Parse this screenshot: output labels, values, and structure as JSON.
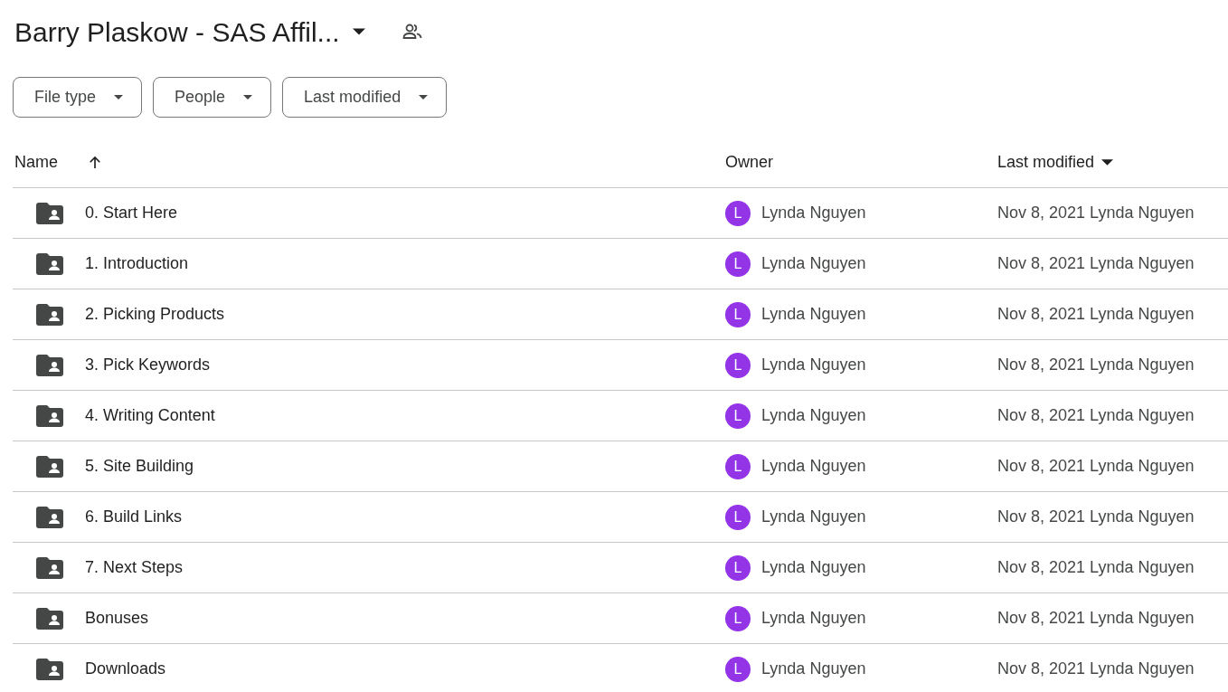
{
  "folder_title": "Barry Plaskow - SAS Affil...",
  "filters": [
    {
      "label": "File type"
    },
    {
      "label": "People"
    },
    {
      "label": "Last modified"
    }
  ],
  "columns": [
    {
      "label": "Name"
    },
    {
      "label": "Owner"
    },
    {
      "label": "Last modified"
    }
  ],
  "rows": [
    {
      "name": "0. Start Here",
      "owner_initial": "L",
      "owner": "Lynda Nguyen",
      "modified_date": "Nov 8, 2021",
      "modified_by": "Lynda Nguyen"
    },
    {
      "name": "1. Introduction",
      "owner_initial": "L",
      "owner": "Lynda Nguyen",
      "modified_date": "Nov 8, 2021",
      "modified_by": "Lynda Nguyen"
    },
    {
      "name": "2. Picking Products",
      "owner_initial": "L",
      "owner": "Lynda Nguyen",
      "modified_date": "Nov 8, 2021",
      "modified_by": "Lynda Nguyen"
    },
    {
      "name": "3. Pick Keywords",
      "owner_initial": "L",
      "owner": "Lynda Nguyen",
      "modified_date": "Nov 8, 2021",
      "modified_by": "Lynda Nguyen"
    },
    {
      "name": "4. Writing Content",
      "owner_initial": "L",
      "owner": "Lynda Nguyen",
      "modified_date": "Nov 8, 2021",
      "modified_by": "Lynda Nguyen"
    },
    {
      "name": "5. Site Building",
      "owner_initial": "L",
      "owner": "Lynda Nguyen",
      "modified_date": "Nov 8, 2021",
      "modified_by": "Lynda Nguyen"
    },
    {
      "name": "6. Build Links",
      "owner_initial": "L",
      "owner": "Lynda Nguyen",
      "modified_date": "Nov 8, 2021",
      "modified_by": "Lynda Nguyen"
    },
    {
      "name": "7. Next Steps",
      "owner_initial": "L",
      "owner": "Lynda Nguyen",
      "modified_date": "Nov 8, 2021",
      "modified_by": "Lynda Nguyen"
    },
    {
      "name": "Bonuses",
      "owner_initial": "L",
      "owner": "Lynda Nguyen",
      "modified_date": "Nov 8, 2021",
      "modified_by": "Lynda Nguyen"
    },
    {
      "name": "Downloads",
      "owner_initial": "L",
      "owner": "Lynda Nguyen",
      "modified_date": "Nov 8, 2021",
      "modified_by": "Lynda Nguyen"
    }
  ]
}
